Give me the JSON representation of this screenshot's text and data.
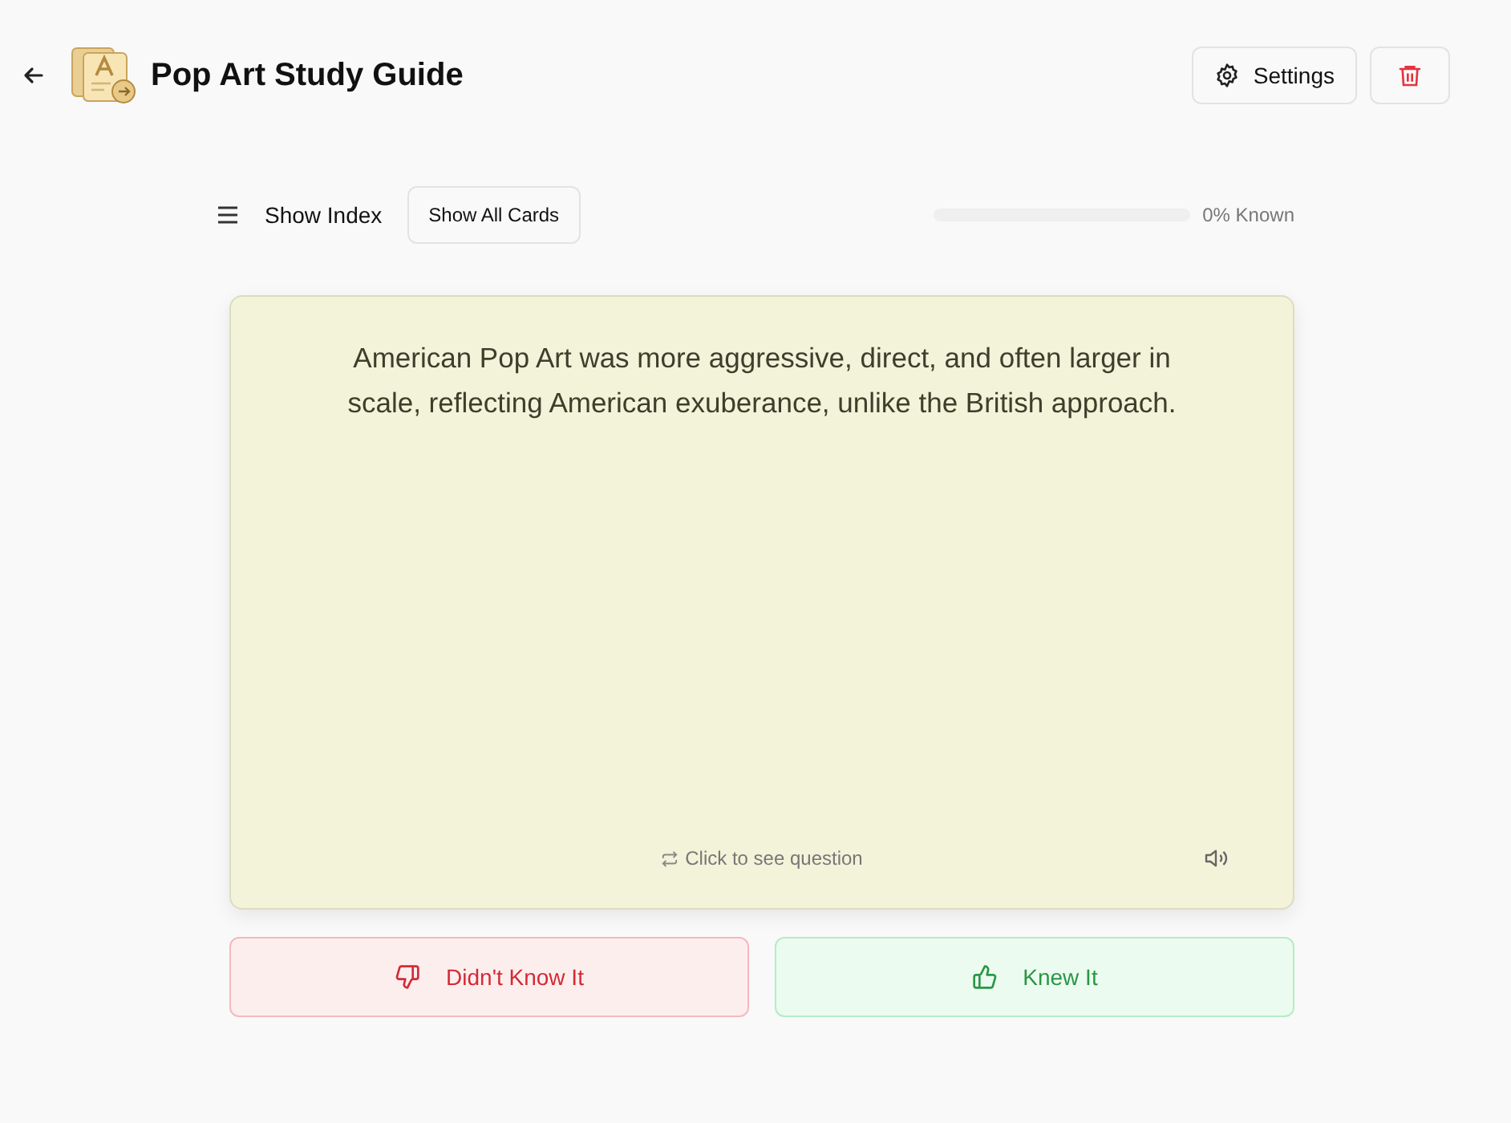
{
  "header": {
    "title": "Pop Art Study Guide",
    "settings_label": "Settings"
  },
  "toolbar": {
    "index_label": "Show Index",
    "show_all_label": "Show All Cards",
    "progress": {
      "level": 0,
      "reading": "0% Known"
    }
  },
  "card": {
    "text": "American Pop Art was more aggressive, direct, and often larger in scale, reflecting American exuberance, unlike the British approach.",
    "flip_hint": "Click to see question"
  },
  "answers": [
    {
      "kind": "negative",
      "label": "Didn't Know It"
    },
    {
      "kind": "positive",
      "label": "Knew It"
    }
  ]
}
